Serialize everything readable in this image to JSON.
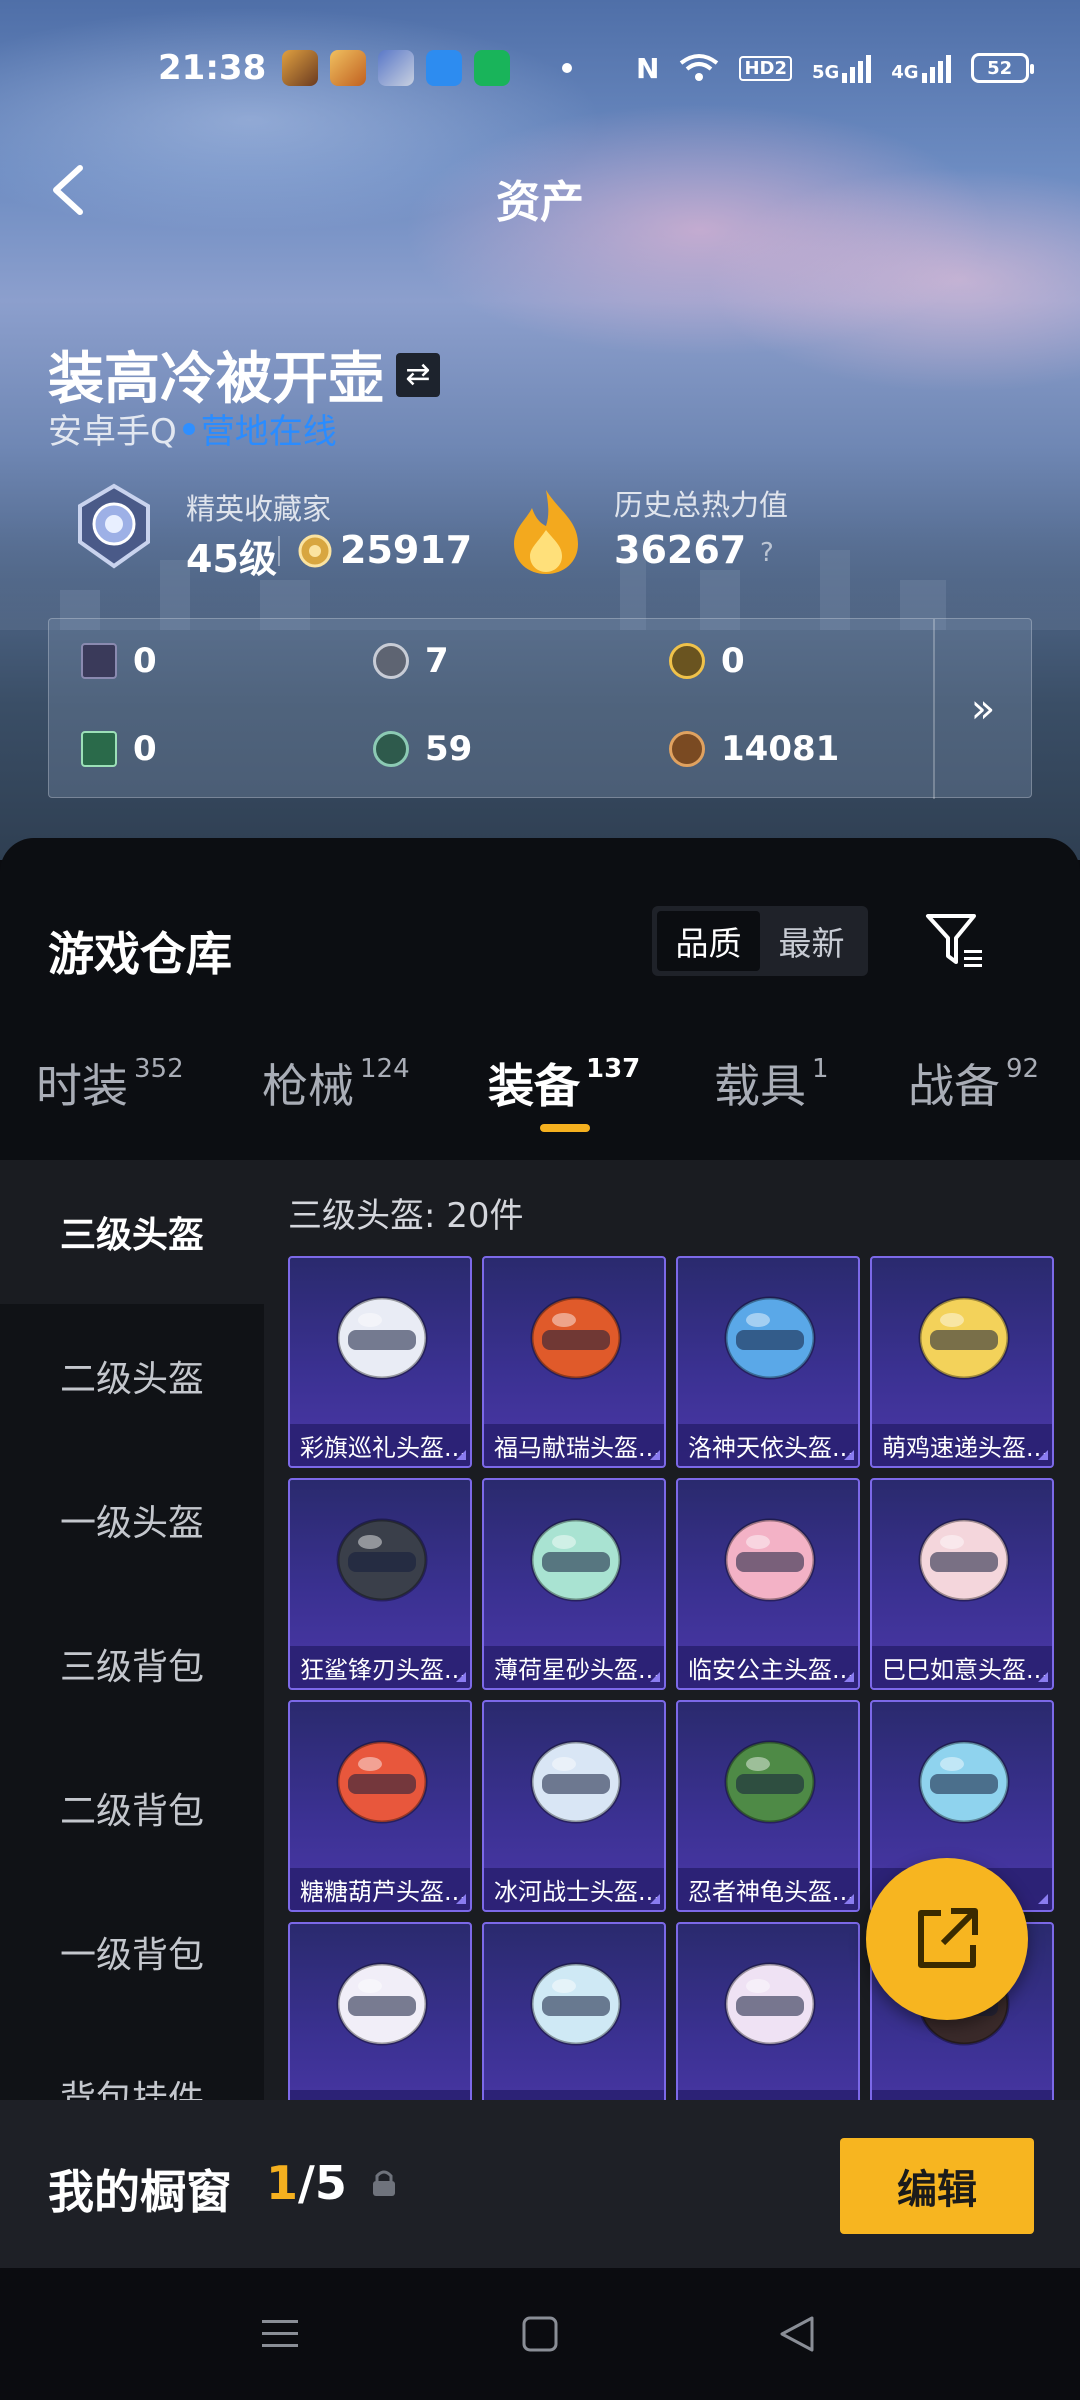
{
  "status_bar": {
    "time": "21:38",
    "battery": "52",
    "network_labels": [
      "HD2",
      "5G",
      "4G"
    ]
  },
  "header": {
    "title": "资产",
    "back_icon": "chevron-left-icon"
  },
  "profile": {
    "nickname": "装高冷被开壶",
    "platform": "安卓手Q",
    "online_status": "营地在线",
    "collector_title": "精英收藏家",
    "collector_level": "45级",
    "collector_points": "25917",
    "heat_label": "历史总热力值",
    "heat_value": "36267",
    "heat_help": "?"
  },
  "currencies": [
    {
      "icon": "card-purple-icon",
      "value": "0"
    },
    {
      "icon": "coin-silver-icon",
      "value": "7"
    },
    {
      "icon": "coin-gold-icon",
      "value": "0"
    },
    {
      "icon": "card-green-icon",
      "value": "0"
    },
    {
      "icon": "coin-green-icon",
      "value": "59"
    },
    {
      "icon": "coin-bronze-icon",
      "value": "14081"
    }
  ],
  "currency_more": "»",
  "warehouse": {
    "title": "游戏仓库",
    "sort_options": [
      "品质",
      "最新"
    ],
    "sort_selected": "品质",
    "tabs": [
      {
        "label": "时装",
        "count": "352"
      },
      {
        "label": "枪械",
        "count": "124"
      },
      {
        "label": "装备",
        "count": "137"
      },
      {
        "label": "载具",
        "count": "1"
      },
      {
        "label": "战备",
        "count": "92"
      }
    ],
    "active_tab": "装备",
    "categories": [
      "三级头盔",
      "二级头盔",
      "一级头盔",
      "三级背包",
      "二级背包",
      "一级背包",
      "背包挂件"
    ],
    "active_category": "三级头盔",
    "count_label": "三级头盔: 20件",
    "items": [
      {
        "name": "彩旗巡礼头盔...",
        "color": "#e9ecf5"
      },
      {
        "name": "福马献瑞头盔...",
        "color": "#e05a2a"
      },
      {
        "name": "洛神天依头盔...",
        "color": "#5aa8e8"
      },
      {
        "name": "萌鸡速递头盔...",
        "color": "#f3d25a"
      },
      {
        "name": "狂鲨锋刃头盔...",
        "color": "#3a3f4a"
      },
      {
        "name": "薄荷星砂头盔...",
        "color": "#a9e3d2"
      },
      {
        "name": "临安公主头盔...",
        "color": "#f3b2c6"
      },
      {
        "name": "巳巳如意头盔...",
        "color": "#f4d6dc"
      },
      {
        "name": "糖糖葫芦头盔...",
        "color": "#e8573c"
      },
      {
        "name": "冰河战士头盔...",
        "color": "#d9e6f5"
      },
      {
        "name": "忍者神龟头盔...",
        "color": "#4e8a46"
      },
      {
        "name": "",
        "color": "#8fd3ee"
      },
      {
        "name": "",
        "color": "#f1eef8"
      },
      {
        "name": "",
        "color": "#cfe9f5"
      },
      {
        "name": "",
        "color": "#efe2f4"
      },
      {
        "name": "",
        "color": "#3a2a2a"
      }
    ]
  },
  "my_window": {
    "title": "我的橱窗",
    "current": "1",
    "total": "/5",
    "edit_label": "编辑"
  }
}
